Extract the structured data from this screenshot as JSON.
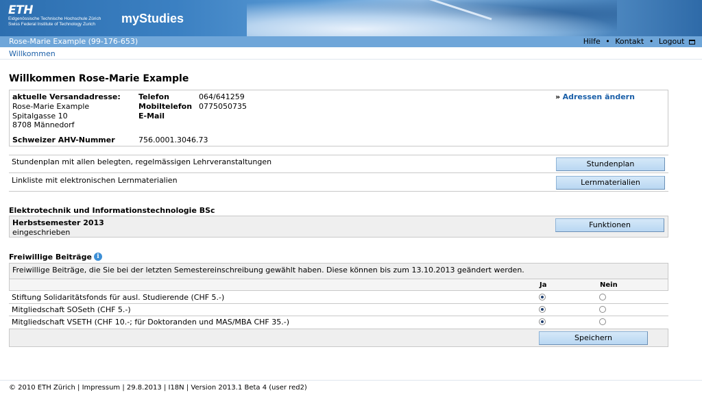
{
  "header": {
    "logo_mark": "ETH",
    "logo_line1": "Eidgenössische Technische Hochschule Zürich",
    "logo_line2": "Swiss Federal Institute of Technology Zurich",
    "app_title": "myStudies"
  },
  "navbar": {
    "user": "Rose-Marie Example (99-176-653)",
    "help": "Hilfe",
    "contact": "Kontakt",
    "logout": "Logout",
    "separator": "•"
  },
  "breadcrumb": "Willkommen",
  "page_title": "Willkommen Rose-Marie Example",
  "address": {
    "label": "aktuelle Versandadresse:",
    "name": "Rose-Marie Example",
    "street": "Spitalgasse 10",
    "city": "8708 Männedorf",
    "phone_label": "Telefon",
    "phone": "064/641259",
    "mobile_label": "Mobiltelefon",
    "mobile": "0775050735",
    "email_label": "E-Mail",
    "ahv_label": "Schweizer AHV-Nummer",
    "ahv": "756.0001.3046.73",
    "change_link_prefix": "»",
    "change_link": "Adressen ändern"
  },
  "rows": [
    {
      "text": "Stundenplan mit allen belegten, regelmässigen Lehrveranstaltungen",
      "button": "Stundenplan"
    },
    {
      "text": "Linkliste mit elektronischen Lernmaterialien",
      "button": "Lernmaterialien"
    }
  ],
  "program": {
    "title": "Elektrotechnik und Informationstechnologie BSc",
    "semester": "Herbstsemester 2013",
    "status": "eingeschrieben",
    "button": "Funktionen"
  },
  "contributions": {
    "title": "Freiwillige Beiträge",
    "info_icon": "i",
    "description": "Freiwillige Beiträge, die Sie bei der letzten Semestereinschreibung gewählt haben. Diese können bis zum 13.10.2013 geändert werden.",
    "col_yes": "Ja",
    "col_no": "Nein",
    "items": [
      {
        "label": "Stiftung Solidaritätsfonds für ausl. Studierende (CHF 5.-)",
        "selected": "Ja"
      },
      {
        "label": "Mitgliedschaft SOSeth (CHF 5.-)",
        "selected": "Ja"
      },
      {
        "label": "Mitgliedschaft VSETH (CHF 10.-; für Doktoranden und MAS/MBA CHF 35.-)",
        "selected": "Ja"
      }
    ],
    "save_button": "Speichern"
  },
  "footer": "© 2010 ETH Zürich | Impressum | 29.8.2013 | I18N | Version 2013.1 Beta 4 (user red2)",
  "colors": {
    "banner": "#3b80c2",
    "navbar": "#6fa6d9",
    "link": "#1a5fa8",
    "button": "#c7e0f5"
  }
}
